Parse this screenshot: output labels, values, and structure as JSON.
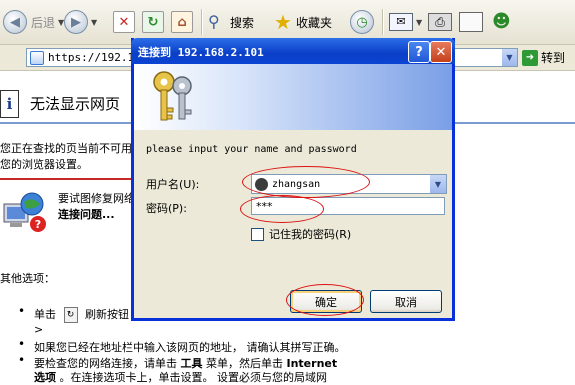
{
  "toolbar": {
    "back_label": "后退",
    "search_label": "搜索",
    "favorites_label": "收藏夹"
  },
  "address": {
    "url": "https://192.16",
    "go_label": "转到"
  },
  "error_page": {
    "title": "无法显示网页",
    "desc_line1": "您正在查找的页当前不可用",
    "desc_line2": "您的浏览器设置。",
    "troubleshoot_line1": "要试图修复网络",
    "troubleshoot_line2": "连接问题...",
    "other_options": "其他选项：",
    "bullet1_prefix": "单击",
    "bullet1_suffix": "刷新按钮",
    "bullet1_cont": ">",
    "bullet2": "如果您已经在地址栏中输入该网页的地址， 请确认其拼写正确。",
    "bullet3_a": "要检查您的网络连接，请单击",
    "bullet3_b": "工具",
    "bullet3_c": "菜单，然后单击",
    "bullet3_d": "Internet",
    "bullet4_a": "选项",
    "bullet4_b": "。在连接选项卡上，单击设置。 设置必须与您的局域网"
  },
  "dialog": {
    "title": "连接到 192.168.2.101",
    "help": "?",
    "close": "✕",
    "prompt": "please input your name and password",
    "username_label": "用户名(U):",
    "username_value": "zhangsan",
    "password_label": "密码(P):",
    "password_value": "***",
    "remember_label": "记住我的密码(R)",
    "ok_label": "确定",
    "cancel_label": "取消"
  },
  "colors": {
    "title_blue": "#0a3fc8",
    "annotation_red": "#dd1111"
  },
  "icons": [
    "back-arrow-icon",
    "forward-arrow-icon",
    "stop-icon",
    "refresh-icon",
    "home-icon",
    "search-icon",
    "favorites-star-icon",
    "history-icon",
    "mail-icon",
    "print-icon",
    "edit-icon",
    "messenger-icon",
    "page-icon",
    "go-arrow-icon",
    "info-icon",
    "network-icon",
    "keys-icon",
    "user-icon"
  ]
}
